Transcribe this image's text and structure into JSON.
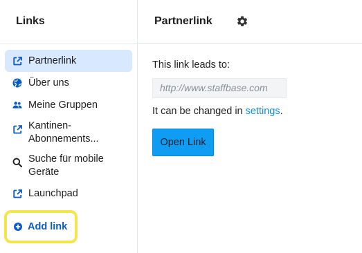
{
  "sidebar": {
    "title": "Links",
    "items": [
      {
        "label": "Partnerlink",
        "icon": "external-link-icon",
        "active": true
      },
      {
        "label": "Über uns",
        "icon": "globe-icon"
      },
      {
        "label": "Meine Gruppen",
        "icon": "group-icon"
      },
      {
        "label": "Kantinen-\nAbonnements...",
        "icon": "external-link-icon"
      },
      {
        "label": "Suche für mobile Geräte",
        "icon": "search-icon"
      },
      {
        "label": "Launchpad",
        "icon": "external-link-icon"
      }
    ],
    "add_link": {
      "label": "Add link",
      "icon": "plus-circle-icon",
      "highlight_color": "#f5e54b"
    }
  },
  "main": {
    "title": "Partnerlink",
    "settings_icon": "gear-icon",
    "lead_text": "This link leads to:",
    "url_placeholder": "http://www.staffbase.com",
    "change_text": "It can be changed in ",
    "settings_link": "settings",
    "change_suffix": ".",
    "open_button": "Open Link"
  },
  "colors": {
    "accent": "#0f9cf3",
    "active_bg": "#d7e8ff",
    "link": "#0b8fe0",
    "icon_blue": "#0a5bc4"
  }
}
